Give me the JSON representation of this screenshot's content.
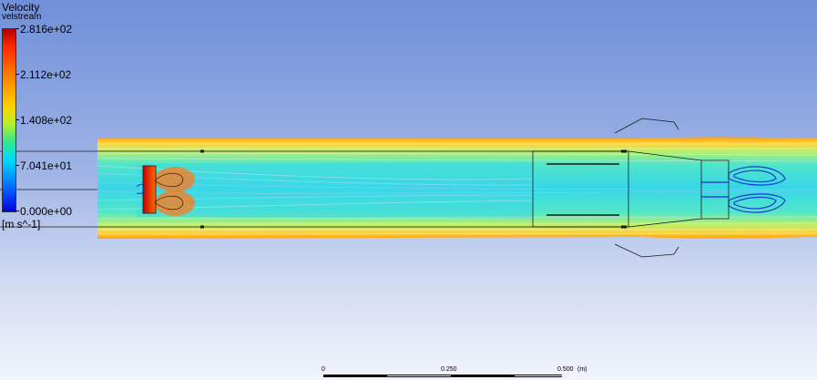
{
  "legend": {
    "title": "Velocity",
    "variable": "velstream",
    "ticks": [
      "2.816e+02",
      "2.112e+02",
      "1.408e+02",
      "7.041e+01",
      "0.000e+00"
    ],
    "units": "[m s^-1]"
  },
  "scale_bar": {
    "labels": [
      "0",
      "0.250",
      "0.500"
    ],
    "unit": "(m)"
  },
  "colors": {
    "background_top": "#6f8fd8",
    "background_bottom": "#f1f4fb",
    "outer_stream": "#ffb000",
    "shear_layer": "#ffe04a",
    "core_flow": "#c8ef6a",
    "recirculation": "#1a3bd0"
  }
}
